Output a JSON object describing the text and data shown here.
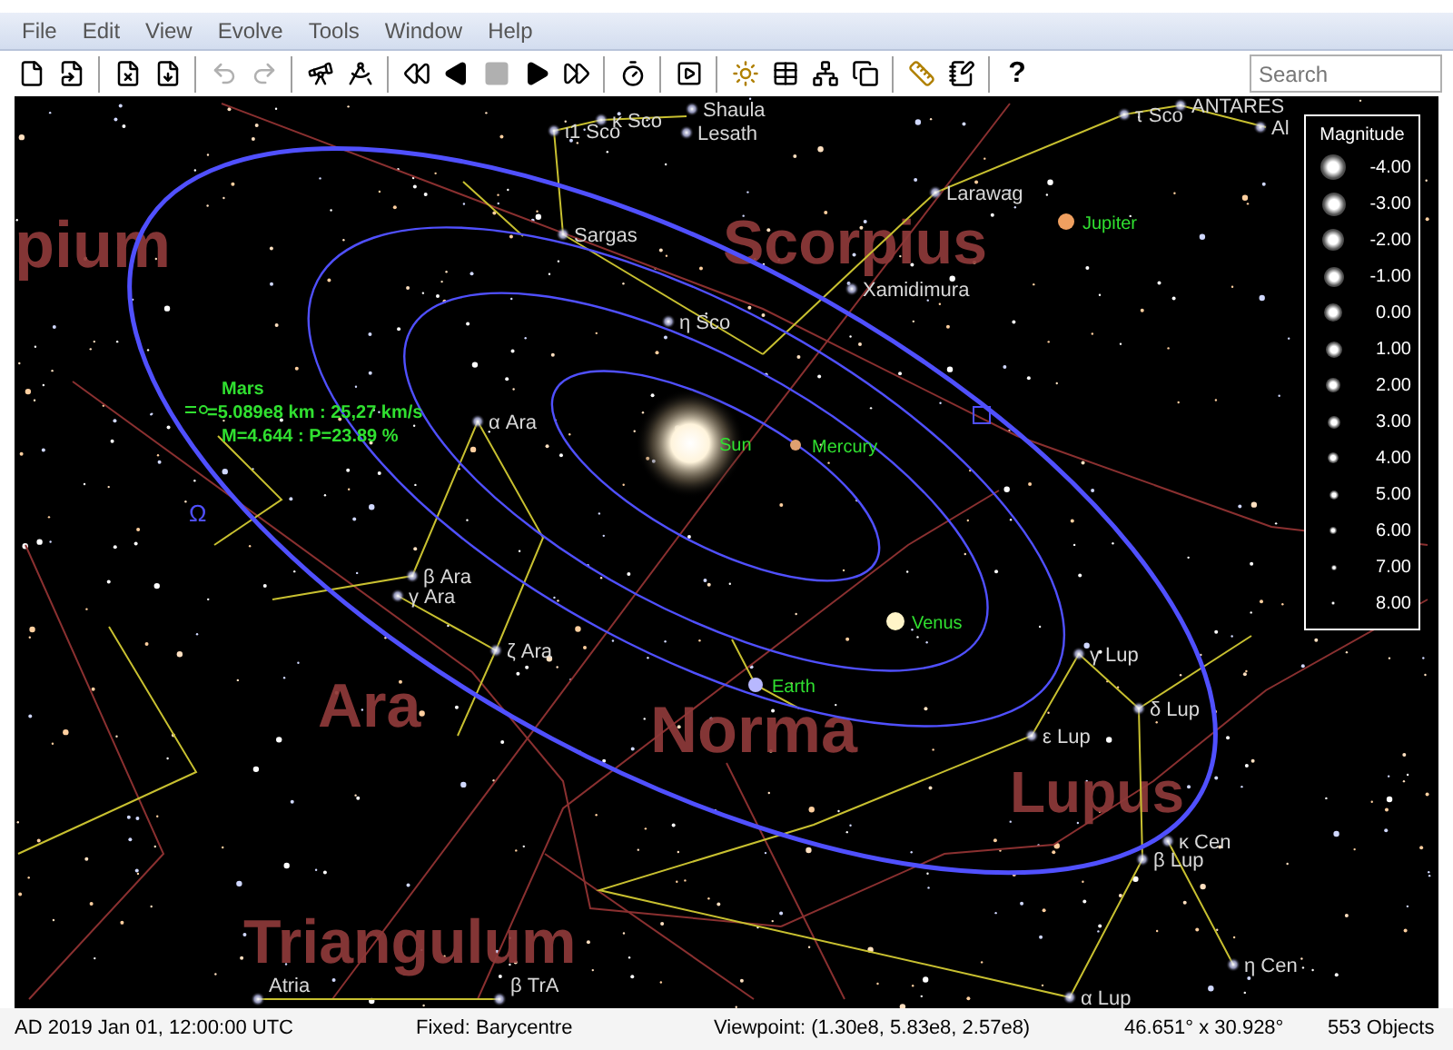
{
  "menu": [
    {
      "label": "File"
    },
    {
      "label": "Edit"
    },
    {
      "label": "View"
    },
    {
      "label": "Evolve"
    },
    {
      "label": "Tools"
    },
    {
      "label": "Window"
    },
    {
      "label": "Help"
    }
  ],
  "toolbar": [
    {
      "kind": "new",
      "disabled": false
    },
    {
      "kind": "open",
      "disabled": false
    },
    {
      "kind": "separator"
    },
    {
      "kind": "close",
      "disabled": false
    },
    {
      "kind": "export",
      "disabled": false
    },
    {
      "kind": "separator"
    },
    {
      "kind": "undo",
      "disabled": true
    },
    {
      "kind": "redo",
      "disabled": true
    },
    {
      "kind": "separator"
    },
    {
      "kind": "telescope",
      "disabled": false
    },
    {
      "kind": "angle",
      "disabled": false
    },
    {
      "kind": "separator"
    },
    {
      "kind": "fast-back",
      "disabled": false
    },
    {
      "kind": "back",
      "disabled": false
    },
    {
      "kind": "stop",
      "disabled": true
    },
    {
      "kind": "play",
      "disabled": false
    },
    {
      "kind": "fast-forward",
      "disabled": false
    },
    {
      "kind": "separator"
    },
    {
      "kind": "timer",
      "disabled": false
    },
    {
      "kind": "separator"
    },
    {
      "kind": "frame",
      "disabled": false
    },
    {
      "kind": "separator"
    },
    {
      "kind": "sun",
      "disabled": false
    },
    {
      "kind": "table",
      "disabled": false
    },
    {
      "kind": "tree",
      "disabled": false
    },
    {
      "kind": "windows",
      "disabled": false
    },
    {
      "kind": "separator"
    },
    {
      "kind": "ruler",
      "disabled": false
    },
    {
      "kind": "notes",
      "disabled": false
    },
    {
      "kind": "separator"
    },
    {
      "kind": "help",
      "label": "?",
      "disabled": false
    }
  ],
  "search": {
    "placeholder": "Search"
  },
  "sky": {
    "constellations": [
      {
        "name": "pium"
      },
      {
        "name": "Scorpius"
      },
      {
        "name": "Ara"
      },
      {
        "name": "Norma"
      },
      {
        "name": "Lupus"
      },
      {
        "name": "Triangulum"
      }
    ],
    "stars": [
      {
        "label": "Shaula"
      },
      {
        "label": "κ Sco"
      },
      {
        "label": "ι1 Sco"
      },
      {
        "label": "Lesath"
      },
      {
        "label": "τ Sco"
      },
      {
        "label": "ANTARES"
      },
      {
        "label": "Al"
      },
      {
        "label": "Sargas"
      },
      {
        "label": "Larawag"
      },
      {
        "label": "Xamidimura"
      },
      {
        "label": "η Sco"
      },
      {
        "label": "α Ara"
      },
      {
        "label": "β Ara"
      },
      {
        "label": "γ Ara"
      },
      {
        "label": "ζ Ara"
      },
      {
        "label": "γ Lup"
      },
      {
        "label": "δ Lup"
      },
      {
        "label": "ε Lup"
      },
      {
        "label": "κ Cen"
      },
      {
        "label": "β Lup"
      },
      {
        "label": "η Cen"
      },
      {
        "label": "α Lup"
      },
      {
        "label": "Atria"
      },
      {
        "label": "β TrA"
      }
    ],
    "planets": [
      {
        "label": "Jupiter",
        "kind": "giant"
      },
      {
        "label": "Sun",
        "kind": "star"
      },
      {
        "label": "Mercury",
        "kind": "small"
      },
      {
        "label": "Venus",
        "kind": "bright"
      },
      {
        "label": "Earth",
        "kind": "blue"
      }
    ],
    "selected_object": {
      "name": "Mars",
      "lines": [
        "=5.089e8 km : 25,27 km/s",
        "M=4.644 : P=23.89 %"
      ]
    },
    "node_symbol": "Ω"
  },
  "legend": {
    "title": "Magnitude",
    "entries": [
      "-4.00",
      "-3.00",
      "-2.00",
      "-1.00",
      "0.00",
      "1.00",
      "2.00",
      "3.00",
      "4.00",
      "5.00",
      "6.00",
      "7.00",
      "8.00"
    ]
  },
  "status_bar": [
    "AD 2019 Jan 01, 12:00:00 UTC",
    "Fixed: Barycentre",
    "Viewpoint: (1.30e8, 5.83e8, 2.57e8)",
    "46.651° x 30.928°",
    "553 Objects"
  ]
}
